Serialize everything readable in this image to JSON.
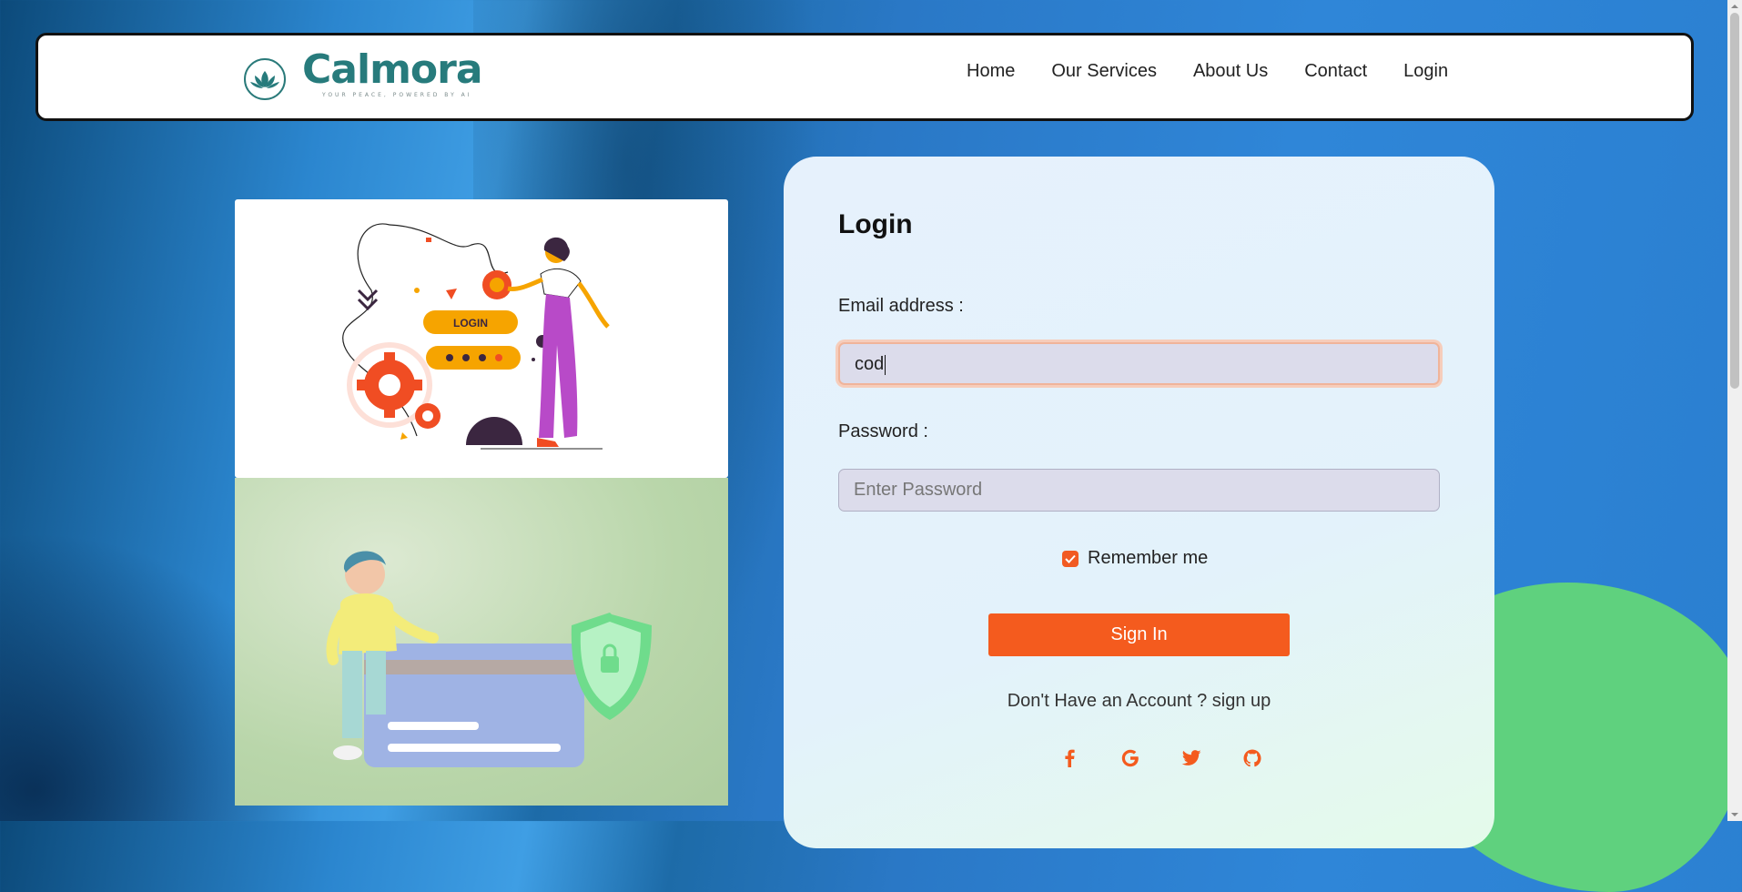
{
  "brand": {
    "name": "Calmora",
    "tagline": "YOUR PEACE, POWERED BY AI",
    "color": "#277b7c"
  },
  "nav": {
    "items": [
      "Home",
      "Our Services",
      "About Us",
      "Contact",
      "Login"
    ]
  },
  "illustration": {
    "login_badge": "LOGIN"
  },
  "login": {
    "title": "Login",
    "email_label": "Email address :",
    "email_value": "cod",
    "password_label": "Password :",
    "password_placeholder": "Enter Password",
    "remember_label": "Remember me",
    "remember_checked": true,
    "signin_label": "Sign In",
    "signup_text": "Don't Have an Account ? sign up",
    "social_icons": [
      "facebook-icon",
      "google-icon",
      "twitter-icon",
      "github-icon"
    ]
  },
  "colors": {
    "accent": "#f45b1e",
    "card_bg": "#e6f1fc",
    "blob": "#5fd17e"
  }
}
